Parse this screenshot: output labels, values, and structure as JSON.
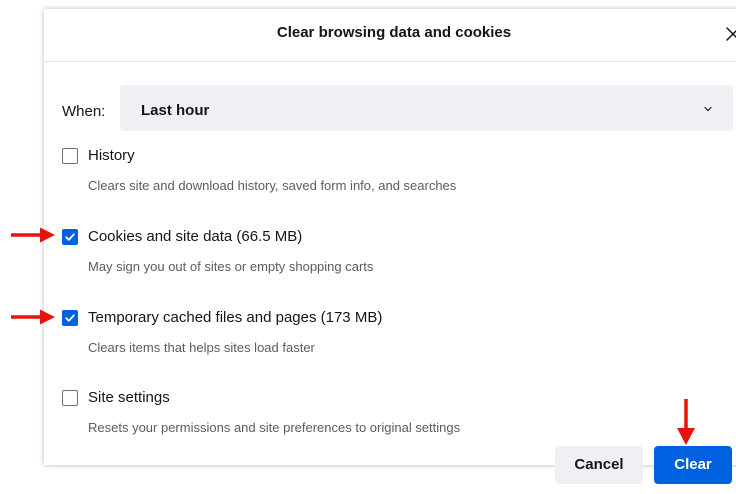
{
  "dialog": {
    "title": "Clear browsing data and cookies",
    "close_icon": "close-icon"
  },
  "when": {
    "label": "When:",
    "selected": "Last hour",
    "chevron_icon": "chevron-down-icon"
  },
  "options": [
    {
      "label": "History",
      "description": "Clears site and download history, saved form info, and searches",
      "checked": false
    },
    {
      "label": "Cookies and site data (66.5 MB)",
      "description": "May sign you out of sites or empty shopping carts",
      "checked": true
    },
    {
      "label": "Temporary cached files and pages (173 MB)",
      "description": "Clears items that helps sites load faster",
      "checked": true
    },
    {
      "label": "Site settings",
      "description": "Resets your permissions and site preferences to original settings",
      "checked": false
    }
  ],
  "buttons": {
    "cancel_label": "Cancel",
    "clear_label": "Clear"
  },
  "colors": {
    "accent": "#0061e0",
    "annotation_arrow": "#e8120c",
    "secondary_button": "#f0f0f4"
  },
  "annotations": {
    "arrow_icon": "red-arrow-icon"
  }
}
